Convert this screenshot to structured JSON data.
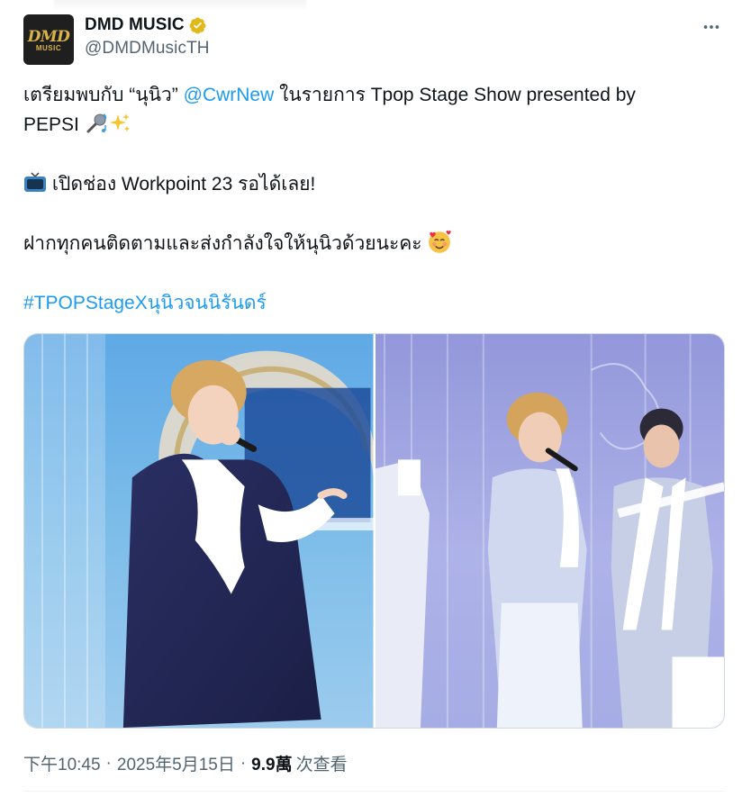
{
  "account": {
    "display_name": "DMD MUSIC",
    "handle": "@DMDMusicTH",
    "verified": true,
    "avatar_text_top": "DMD",
    "avatar_text_bottom": "MUSIC",
    "avatar_colors": {
      "background": "#1f1f1f",
      "logo": "#d8b24a"
    },
    "verified_badge_color": "#e2b719"
  },
  "menu": {
    "more_icon": "more-horizontal-icon"
  },
  "tweet": {
    "line1_before": "เตรียมพบกับ “นุนิว” ",
    "mention": "@CwrNew",
    "line1_after": " ในรายการ Tpop Stage Show presented by",
    "line2": "PEPSI ",
    "line2_emojis": [
      "microphone-emoji",
      "sparkles-emoji"
    ],
    "line3_emoji": "television-emoji",
    "line3": " เปิดช่อง Workpoint 23 รอได้เลย!",
    "line4": "ฝากทุกคนติดตามและส่งกำลังใจให้นุนิวด้วยนะคะ ",
    "line4_emoji": "smiling-face-with-hearts-emoji",
    "hashtag": "#TPOPStageXนุนิวจนนิรันดร์"
  },
  "media": {
    "photos": [
      {
        "name": "photo-singer-solo",
        "description_icon": "photo"
      },
      {
        "name": "photo-stage-duo",
        "description_icon": "photo"
      }
    ]
  },
  "meta": {
    "time": "下午10:45",
    "separator": "·",
    "date": "2025年5月15日",
    "views_count": "9.9萬",
    "views_label": "次查看"
  },
  "colors": {
    "text": "#0f1419",
    "secondary": "#536471",
    "link": "#1d9bf0",
    "border": "#cfd9de"
  }
}
